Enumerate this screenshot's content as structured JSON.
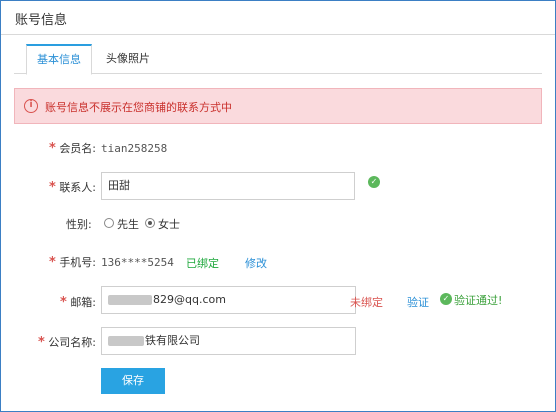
{
  "header": {
    "title": "账号信息"
  },
  "tabs": [
    {
      "label": "基本信息",
      "active": true
    },
    {
      "label": "头像照片",
      "active": false
    }
  ],
  "alert": {
    "icon": "info-icon",
    "text": "账号信息不展示在您商铺的联系方式中"
  },
  "form": {
    "member": {
      "label": "会员名:",
      "value": "tian258258"
    },
    "contact": {
      "label": "联系人:",
      "value": "田甜",
      "status_icon": "check-icon"
    },
    "gender": {
      "label": "性别:",
      "options": [
        "先生",
        "女士"
      ],
      "selected": "女士"
    },
    "mobile": {
      "label": "手机号:",
      "value": "136****5254",
      "bound_text": "已绑定",
      "edit_link": "修改"
    },
    "email": {
      "label": "邮箱:",
      "value_visible": "829@qq.com",
      "unbound_text": "未绑定",
      "verify_link": "验证",
      "verified_text": "验证通过!"
    },
    "company": {
      "label": "公司名称:",
      "value_visible": "铁有限公司"
    }
  },
  "save_button": "保存",
  "colors": {
    "accent": "#29a3e2",
    "alert_bg": "#fadadd",
    "required": "#d9534f",
    "success": "#1ea83c"
  }
}
